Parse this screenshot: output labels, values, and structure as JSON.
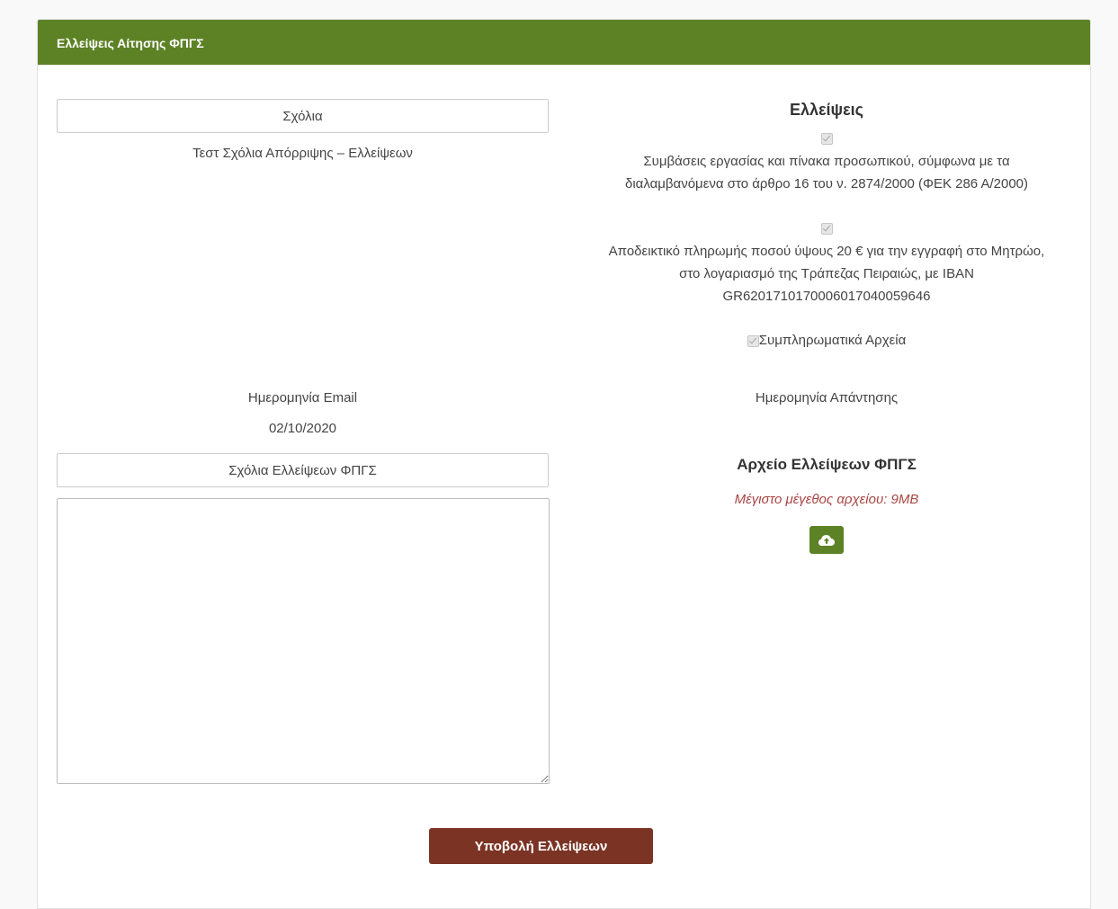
{
  "panel": {
    "title": "Ελλείψεις Αίτησης ΦΠΓΣ"
  },
  "left": {
    "comments_label": "Σχόλια",
    "comments_text": "Τεστ Σχόλια Απόρριψης – Ελλείψεων",
    "email_date_label": "Ημερομηνία Email",
    "email_date_value": "02/10/2020",
    "deficiency_comments_label": "Σχόλια Ελλείψεων ΦΠΓΣ",
    "deficiency_comments_value": ""
  },
  "right": {
    "deficiencies_title": "Ελλείψεις",
    "items": [
      {
        "checked": true,
        "text": "Συμβάσεις εργασίας και πίνακα προσωπικού, σύμφωνα με τα διαλαμβανόμενα στο άρθρο 16 του ν. 2874/2000 (ΦΕΚ 286 Α/2000)"
      },
      {
        "checked": true,
        "text": "Αποδεικτικό πληρωμής ποσού ύψους 20 € για την εγγραφή στο Μητρώο, στο λογαριασμό της Τράπεζας Πειραιώς, με IBAN GR6201710170006017040059646"
      }
    ],
    "supplementary": {
      "checked": true,
      "label": "Συμπληρωματικά Αρχεία"
    },
    "reply_date_label": "Ημερομηνία Απάντησης",
    "file_title": "Αρχείο Ελλείψεων ΦΠΓΣ",
    "max_size_note": "Μέγιστο μέγεθος αρχείου: 9MB",
    "upload_icon": "cloud-upload-icon"
  },
  "submit_label": "Υποβολή Ελλείψεων",
  "colors": {
    "header": "#5d8226",
    "submit": "#7b3324",
    "warning": "#a94442"
  }
}
